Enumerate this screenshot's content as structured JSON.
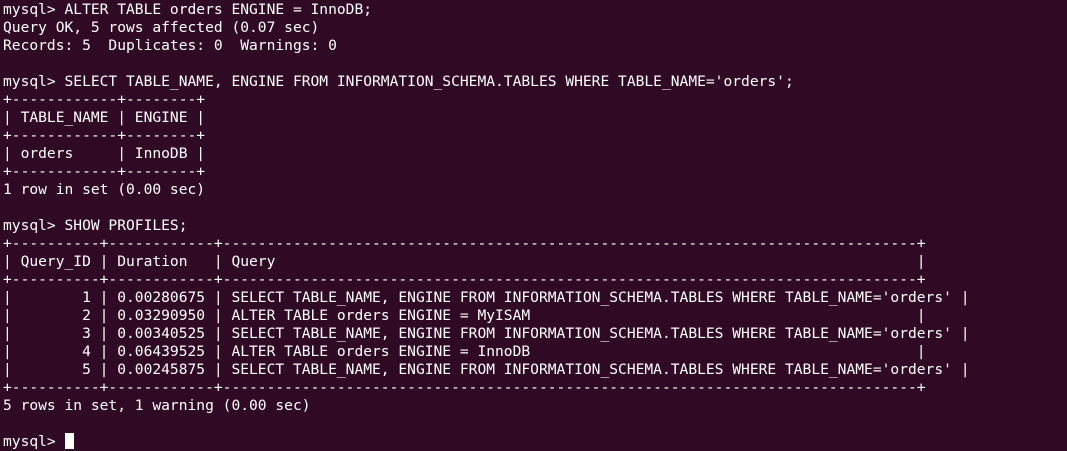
{
  "terminal": {
    "lines": [
      "mysql> ALTER TABLE orders ENGINE = InnoDB;",
      "Query OK, 5 rows affected (0.07 sec)",
      "Records: 5  Duplicates: 0  Warnings: 0",
      "",
      "mysql> SELECT TABLE_NAME, ENGINE FROM INFORMATION_SCHEMA.TABLES WHERE TABLE_NAME='orders';",
      "+------------+--------+",
      "| TABLE_NAME | ENGINE |",
      "+------------+--------+",
      "| orders     | InnoDB |",
      "+------------+--------+",
      "1 row in set (0.00 sec)",
      "",
      "mysql> SHOW PROFILES;",
      "+----------+------------+-------------------------------------------------------------------------------+",
      "| Query_ID | Duration   | Query                                                                         |",
      "+----------+------------+-------------------------------------------------------------------------------+",
      "|        1 | 0.00280675 | SELECT TABLE_NAME, ENGINE FROM INFORMATION_SCHEMA.TABLES WHERE TABLE_NAME='orders' |",
      "|        2 | 0.03290950 | ALTER TABLE orders ENGINE = MyISAM                                            |",
      "|        3 | 0.00340525 | SELECT TABLE_NAME, ENGINE FROM INFORMATION_SCHEMA.TABLES WHERE TABLE_NAME='orders' |",
      "|        4 | 0.06439525 | ALTER TABLE orders ENGINE = InnoDB                                            |",
      "|        5 | 0.00245875 | SELECT TABLE_NAME, ENGINE FROM INFORMATION_SCHEMA.TABLES WHERE TABLE_NAME='orders' |",
      "+----------+------------+-------------------------------------------------------------------------------+",
      "5 rows in set, 1 warning (0.00 sec)",
      ""
    ],
    "prompt": "mysql> ",
    "colors": {
      "background": "#300a24",
      "foreground": "#ffffff"
    }
  }
}
